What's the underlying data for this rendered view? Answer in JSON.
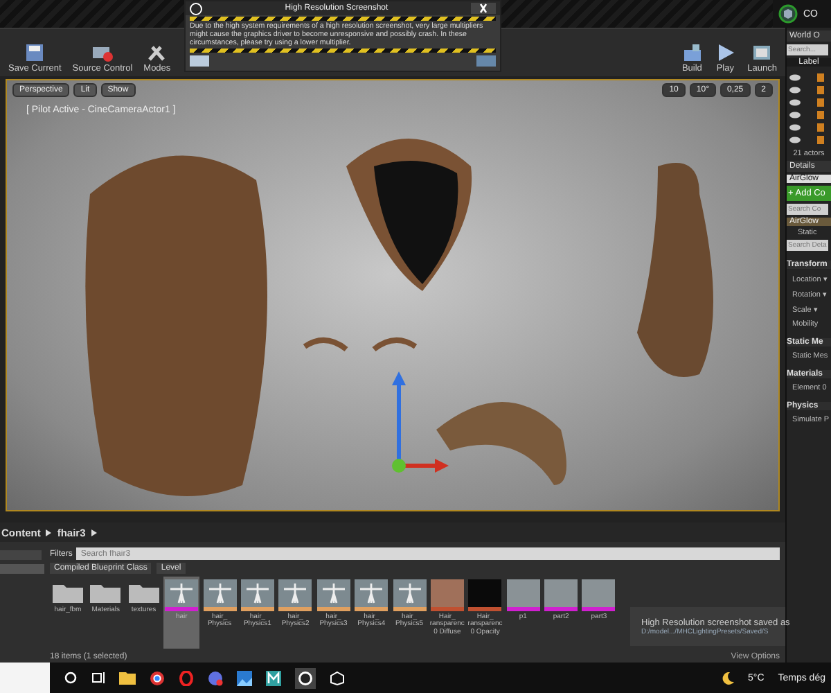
{
  "title_bar": {
    "right_label": "CO"
  },
  "toolbar": {
    "left_buttons": [
      {
        "label": "Save Current",
        "kind": "save"
      },
      {
        "label": "Source Control",
        "kind": "source"
      },
      {
        "label": "Modes",
        "kind": "modes"
      }
    ],
    "right_buttons": [
      {
        "label": "Build",
        "kind": "build"
      },
      {
        "label": "Play",
        "kind": "play"
      },
      {
        "label": "Launch",
        "kind": "launch"
      }
    ]
  },
  "dialog": {
    "title": "High Resolution Screenshot",
    "message": "Due to the high system requirements of a high resolution screenshot, very large multipliers might cause the graphics driver to become unresponsive and possibly crash. In these circumstances, please try using a lower multiplier."
  },
  "viewport": {
    "view_buttons": [
      "Perspective",
      "Lit",
      "Show"
    ],
    "snap_values": [
      "10",
      "10°",
      "0,25",
      "2"
    ],
    "pilot_label": "[ Pilot Active - CineCameraActor1 ]"
  },
  "outliner": {
    "title": "World O",
    "search_placeholder": "Search...",
    "column": "Label",
    "actor_count": "21 actors"
  },
  "details": {
    "title": "Details",
    "actor_name": "AirGlow",
    "add_button": "+ Add Co",
    "search_components_placeholder": "Search Co",
    "component": "AirGlow",
    "subcomponent": "Static",
    "search_details_placeholder": "Search Deta",
    "sections": [
      {
        "title": "Transform",
        "rows": [
          "Location ▾",
          "Rotation ▾",
          "Scale ▾",
          "Mobility"
        ]
      },
      {
        "title": "Static Me",
        "rows": [
          "Static Mes"
        ]
      },
      {
        "title": "Materials",
        "rows": [
          "Element 0"
        ]
      },
      {
        "title": "Physics",
        "rows": [
          "Simulate P"
        ]
      }
    ]
  },
  "content_browser": {
    "path": [
      "Content",
      "fhair3"
    ],
    "filters": "Filters",
    "search_placeholder": "Search fhair3",
    "filter_chips": [
      "Compiled Blueprint Class",
      "Level"
    ],
    "assets": [
      {
        "label": "hair_fbm",
        "kind": "folder",
        "selected": false
      },
      {
        "label": "Materials",
        "kind": "folder",
        "selected": false
      },
      {
        "label": "textures",
        "kind": "folder",
        "selected": false
      },
      {
        "label": "hair",
        "kind": "mesh",
        "color": "#d020d0",
        "selected": true
      },
      {
        "label": "hair_ Physics",
        "kind": "mesh",
        "color": "#e0a060",
        "selected": false
      },
      {
        "label": "hair_ Physics1",
        "kind": "mesh",
        "color": "#e0a060",
        "selected": false
      },
      {
        "label": "hair_ Physics2",
        "kind": "mesh",
        "color": "#e0a060",
        "selected": false
      },
      {
        "label": "hair_ Physics3",
        "kind": "mesh",
        "color": "#e0a060",
        "selected": false
      },
      {
        "label": "hair_ Physics4",
        "kind": "mesh",
        "color": "#e0a060",
        "selected": false
      },
      {
        "label": "hair_ Physics5",
        "kind": "mesh",
        "color": "#e0a060",
        "selected": false
      },
      {
        "label": "Hair_ ransparenc 0 Diffuse",
        "kind": "diffuse",
        "color": "#c05030",
        "selected": false
      },
      {
        "label": "Hair_ ransparenc 0 Opacity",
        "kind": "opacity",
        "color": "#c05030",
        "selected": false
      },
      {
        "label": "p1",
        "kind": "level",
        "color": "#d020d0",
        "selected": false
      },
      {
        "label": "part2",
        "kind": "level",
        "color": "#d020d0",
        "selected": false
      },
      {
        "label": "part3",
        "kind": "level",
        "color": "#d020d0",
        "selected": false
      }
    ],
    "status": "18 items (1 selected)",
    "view_options": "View Options"
  },
  "notification": {
    "title": "High Resolution screenshot saved as",
    "path": "D:/model.../MHCLightingPresets/Saved/S"
  },
  "taskbar": {
    "temperature": "5°C",
    "weather": "Temps dég"
  }
}
